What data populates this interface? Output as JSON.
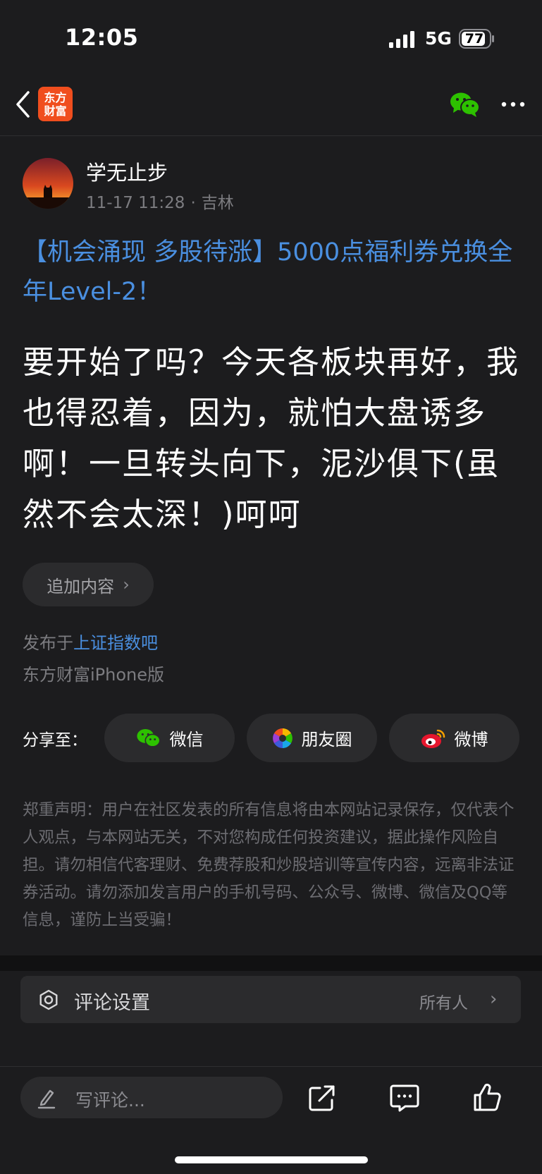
{
  "status_bar": {
    "time": "12:05",
    "network": "5G",
    "battery": "77"
  },
  "nav": {
    "logo_line1": "东方",
    "logo_line2": "财富"
  },
  "post": {
    "author": "学无止步",
    "date": "11-17 11:28",
    "location": "吉林",
    "headline": "【机会涌现 多股待涨】5000点福利券兑换全年Level-2！",
    "body": "要开始了吗？今天各板块再好，我也得忍着，因为，就怕大盘诱多啊！一旦转头向下，泥沙俱下(虽然不会太深！)呵呵",
    "add_content_label": "追加内容",
    "posted_in_prefix": "发布于",
    "posted_in_forum": "上证指数吧",
    "device": "东方财富iPhone版"
  },
  "share": {
    "label": "分享至：",
    "wechat": "微信",
    "moments": "朋友圈",
    "weibo": "微博"
  },
  "disclaimer": "郑重声明：用户在社区发表的所有信息将由本网站记录保存，仅代表个人观点，与本网站无关，不对您构成任何投资建议，据此操作风险自担。请勿相信代客理财、免费荐股和炒股培训等宣传内容，远离非法证券活动。请勿添加发言用户的手机号码、公众号、微博、微信及QQ等信息，谨防上当受骗！",
  "comment_settings": {
    "label": "评论设置",
    "value": "所有人"
  },
  "bottom_bar": {
    "comment_placeholder": "写评论..."
  },
  "colors": {
    "link_blue": "#4a8fe0",
    "brand_orange": "#f04e1e",
    "wechat_green": "#2dc100"
  }
}
